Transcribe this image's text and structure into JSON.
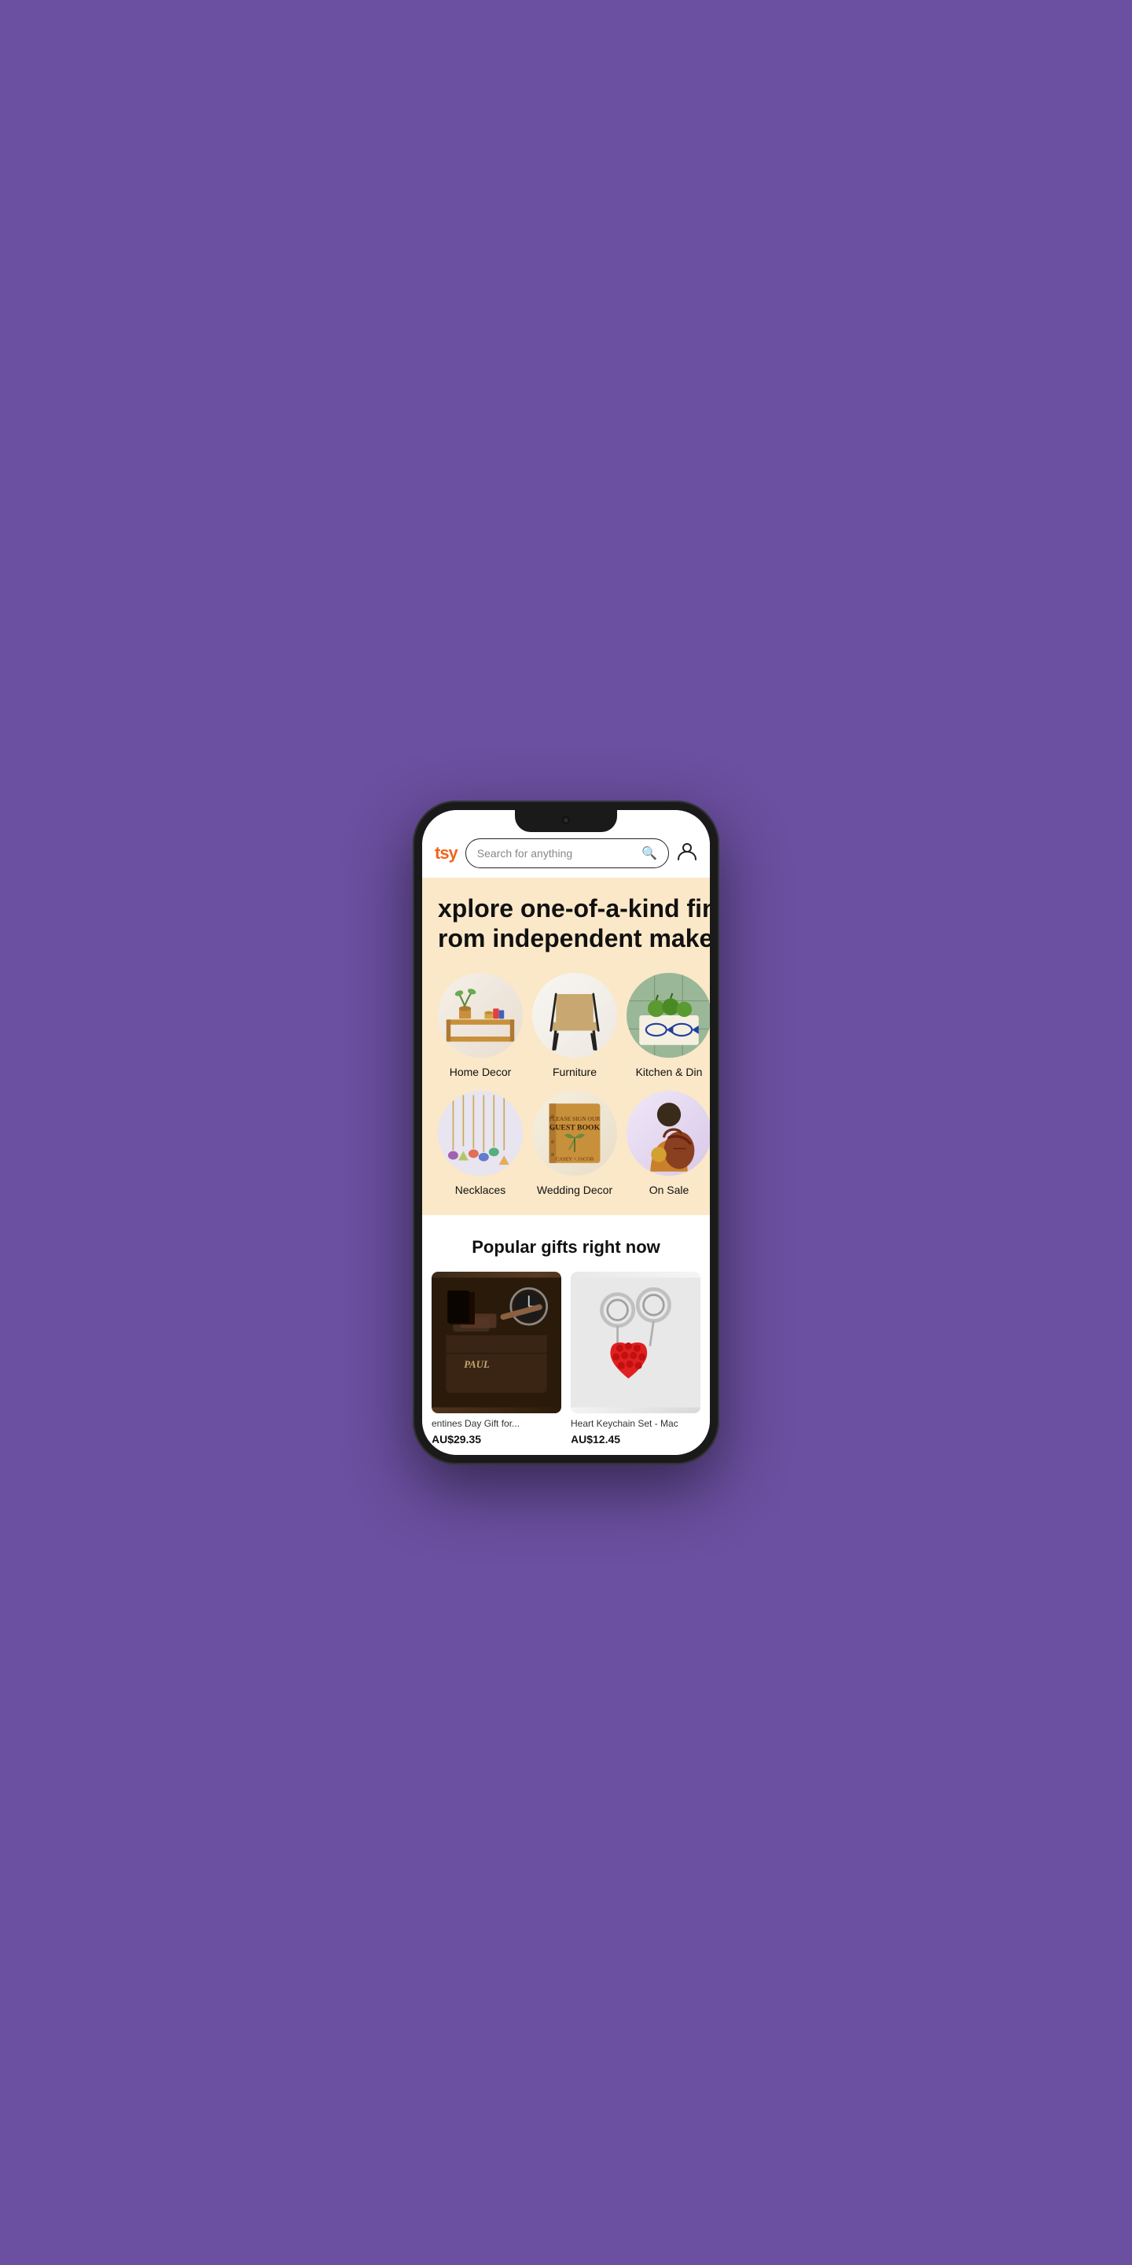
{
  "header": {
    "logo": "tsy",
    "search_placeholder": "Search for anything",
    "search_icon": "🔍",
    "account_icon": "👤"
  },
  "hero": {
    "title": "xplore one-of-a-kind finds\nrom independent makers"
  },
  "categories": [
    {
      "id": "home-decor",
      "label": "Home Decor",
      "style": "home"
    },
    {
      "id": "furniture",
      "label": "Furniture",
      "style": "furniture"
    },
    {
      "id": "kitchen",
      "label": "Kitchen & Din",
      "style": "kitchen"
    },
    {
      "id": "necklaces",
      "label": "Necklaces",
      "style": "necklaces"
    },
    {
      "id": "wedding-decor",
      "label": "Wedding Decor",
      "style": "wedding"
    },
    {
      "id": "on-sale",
      "label": "On Sale",
      "style": "onsale"
    }
  ],
  "popular_section": {
    "title": "Popular gifts right now"
  },
  "products": [
    {
      "id": "wallet",
      "title": "entines Day Gift for...",
      "price": "AU$29.35",
      "style": "wallet"
    },
    {
      "id": "keychain",
      "title": "Heart Keychain Set - Mac",
      "price": "AU$12.45",
      "style": "keychain"
    }
  ]
}
